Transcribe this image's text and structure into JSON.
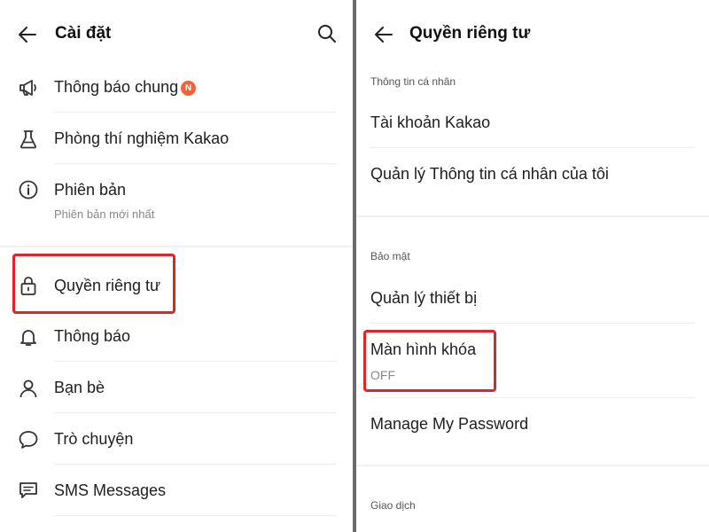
{
  "settings": {
    "title": "Cài đặt",
    "items": [
      {
        "label": "Thông báo chung",
        "icon": "megaphone-icon",
        "badge": "N"
      },
      {
        "label": "Phòng thí nghiệm Kakao",
        "icon": "flask-icon"
      },
      {
        "label": "Phiên bản",
        "sublabel": "Phiên bản mới nhất",
        "icon": "info-icon"
      },
      {
        "label": "Quyền riêng tư",
        "icon": "lock-icon",
        "highlighted": true
      },
      {
        "label": "Thông báo",
        "icon": "bell-icon"
      },
      {
        "label": "Bạn bè",
        "icon": "person-icon"
      },
      {
        "label": "Trò chuyện",
        "icon": "chat-bubble-icon"
      },
      {
        "label": "SMS Messages",
        "icon": "sms-icon"
      }
    ]
  },
  "privacy": {
    "title": "Quyền riêng tư",
    "sections": [
      {
        "header": "Thông tin cá nhân",
        "items": [
          {
            "label": "Tài khoản Kakao"
          },
          {
            "label": "Quản lý Thông tin cá nhân của tôi"
          }
        ]
      },
      {
        "header": "Bảo mật",
        "items": [
          {
            "label": "Quản lý thiết bị"
          },
          {
            "label": "Màn hình khóa",
            "sublabel": "OFF",
            "highlighted": true
          },
          {
            "label": "Manage My Password"
          }
        ]
      },
      {
        "header": "Giao dịch",
        "items": []
      }
    ]
  },
  "colors": {
    "highlight": "#e0242b",
    "badge": "#f2643c",
    "sublabel": "#888888",
    "background": "#ffffff"
  }
}
